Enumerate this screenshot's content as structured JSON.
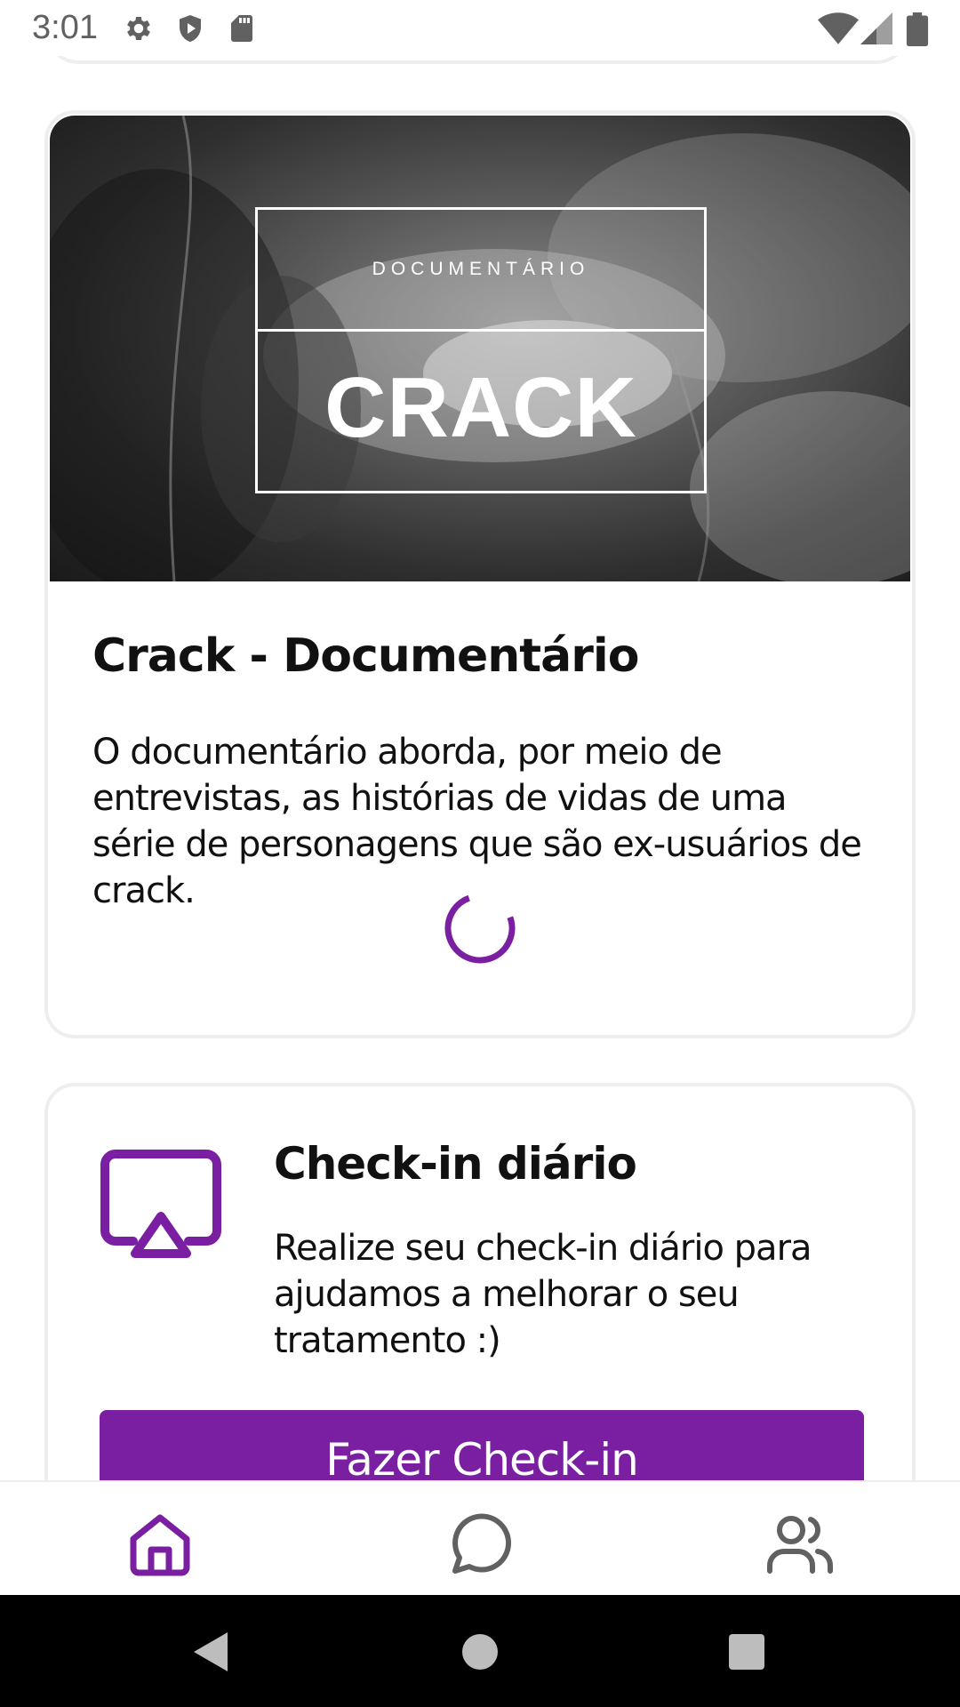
{
  "status_bar": {
    "time": "3:01",
    "icons_left": [
      "gear-icon",
      "shield-icon",
      "sd-card-icon"
    ],
    "icons_right": [
      "wifi-icon",
      "signal-icon",
      "battery-icon"
    ]
  },
  "doc_card": {
    "image_kicker": "DOCUMENTÁRIO",
    "image_title": "CRACK",
    "title": "Crack - Documentário",
    "description": "O documentário aborda, por meio de entrevistas, as histórias de vidas de uma série de personagens que são ex-usuários de crack."
  },
  "checkin_card": {
    "icon": "cast-icon",
    "title": "Check-in diário",
    "description": "Realize seu check-in diário para ajudamos a melhorar o seu tratamento :)",
    "button_label": "Fazer Check-in"
  },
  "bottom_nav": {
    "items": [
      {
        "icon": "home-icon",
        "active": true
      },
      {
        "icon": "chat-icon",
        "active": false
      },
      {
        "icon": "users-icon",
        "active": false
      }
    ]
  },
  "colors": {
    "accent": "#7b1fa2",
    "nav_inactive": "#616161",
    "text": "#111111",
    "card_border": "#eeeeee"
  }
}
